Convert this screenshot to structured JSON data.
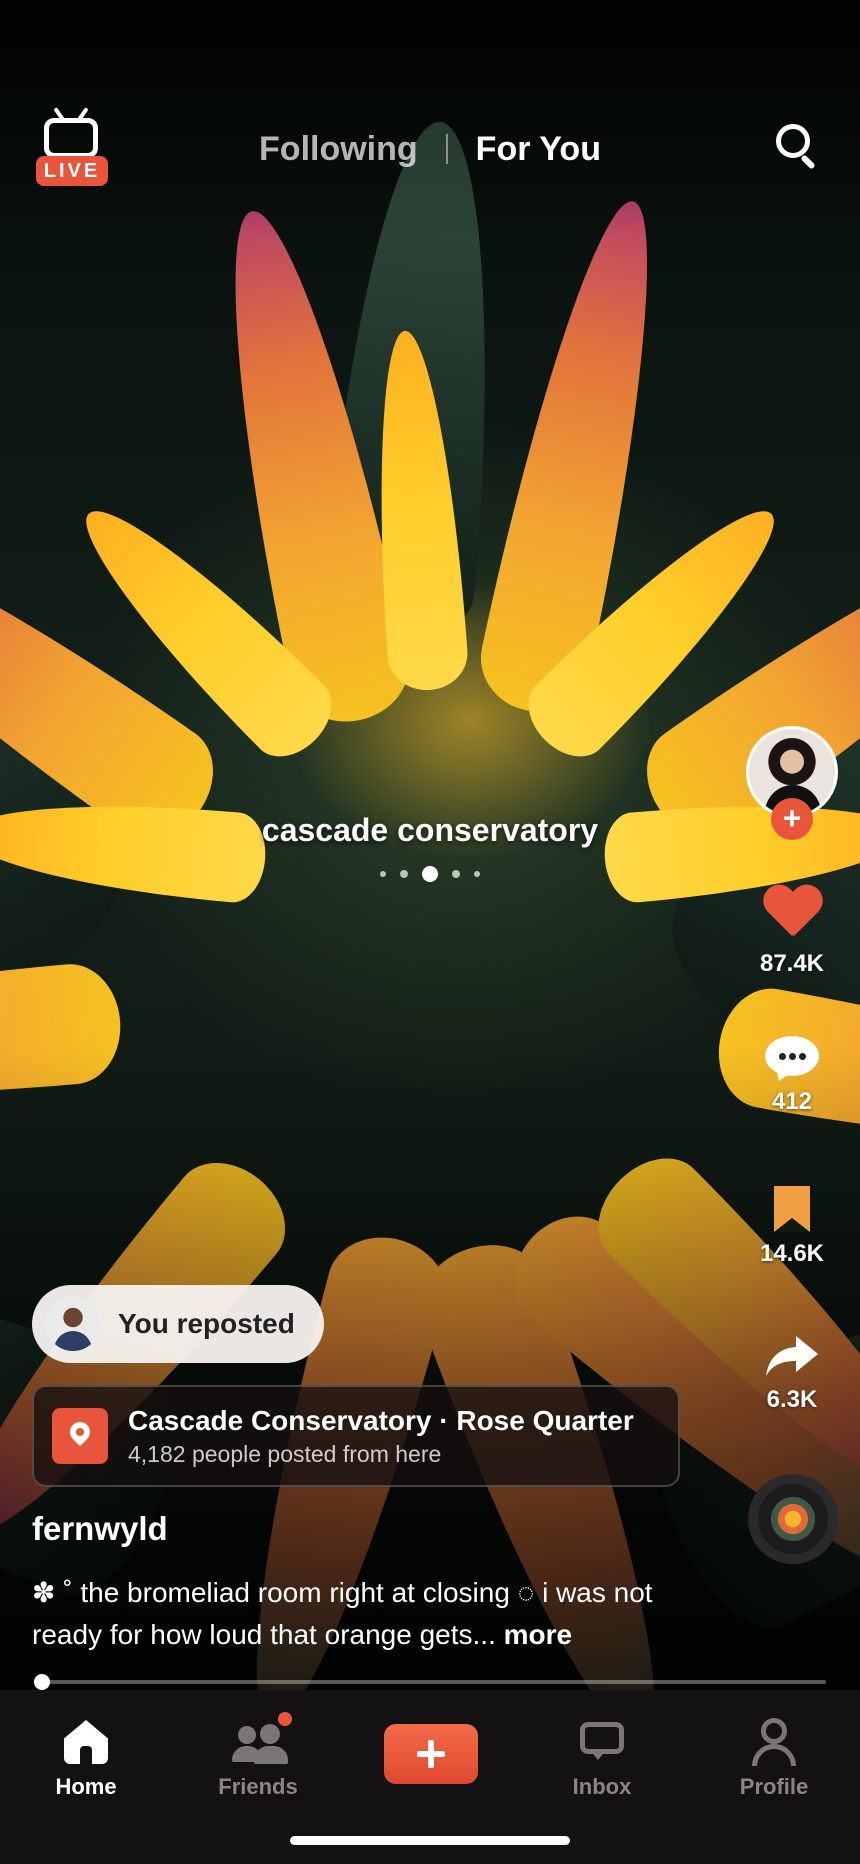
{
  "top_bar": {
    "live_badge": "LIVE",
    "tabs": [
      "Following",
      "For You"
    ],
    "active_tab": "For You",
    "icons": [
      "live-tv-icon",
      "search-icon"
    ]
  },
  "post": {
    "overlay_text": "cascade conservatory",
    "carousel": {
      "total": 5,
      "active_index": 2
    },
    "repost": {
      "label": "You reposted"
    },
    "location": {
      "title": "Cascade Conservatory · Rose Quarter",
      "subtitle": "4,182 people posted from here"
    },
    "username": "fernwyld",
    "caption_lead": "✽ ˚ the bromeliad room right at closing ◌ i was not ready for how loud that orange gets...",
    "caption_more": "more",
    "progress": 0.01
  },
  "actions": {
    "likes": "87.4K",
    "comments": "412",
    "saves": "14.6K",
    "shares": "6.3K",
    "icons": [
      "heart-icon",
      "comment-icon",
      "bookmark-icon",
      "share-icon",
      "plus-icon"
    ]
  },
  "bottom_nav": {
    "items": [
      {
        "label": "Home",
        "icon": "home-icon",
        "active": true
      },
      {
        "label": "Friends",
        "icon": "friends-icon",
        "active": false,
        "has_notification": true
      },
      {
        "label": "",
        "icon": "create-plus-icon",
        "active": false
      },
      {
        "label": "Inbox",
        "icon": "inbox-icon",
        "active": false
      },
      {
        "label": "Profile",
        "icon": "profile-icon",
        "active": false
      }
    ]
  },
  "colors": {
    "accent": "#e8553a",
    "bookmark": "#f0a040",
    "nav_background": "#141112",
    "inactive": "#8a8687"
  }
}
